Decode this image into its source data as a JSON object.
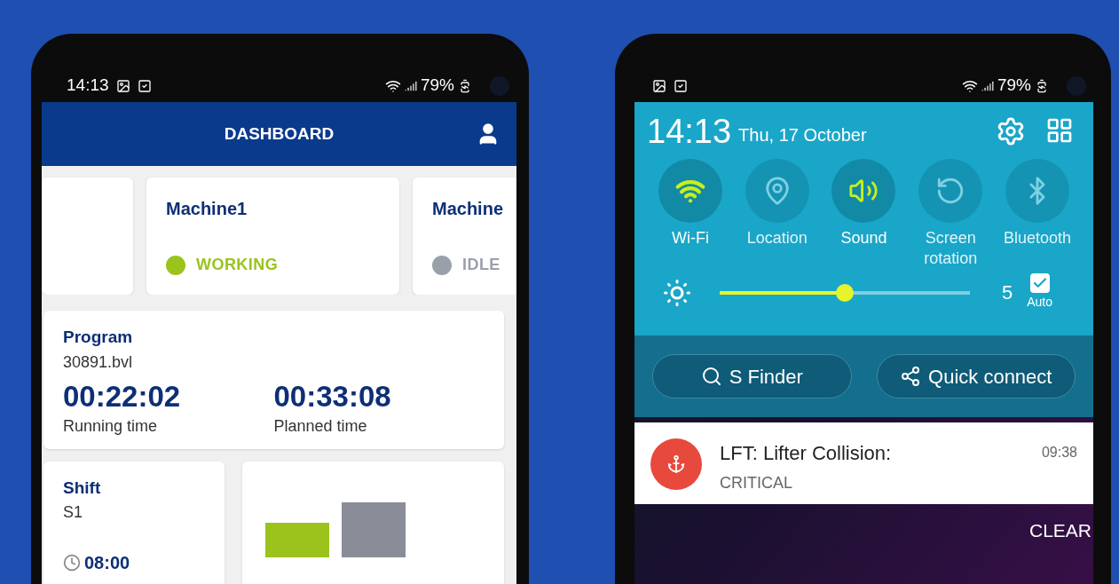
{
  "left_phone": {
    "status_bar": {
      "time": "14:13",
      "battery": "79%"
    },
    "app_bar": {
      "title": "DASHBOARD"
    },
    "machines": [
      {
        "kind": "hidden"
      },
      {
        "kind": "machine",
        "name": "Machine1",
        "status": "WORKING",
        "color": "#9bc31c"
      },
      {
        "kind": "machine",
        "name": "Machine",
        "status": "IDLE",
        "color": "#9aa0aa"
      }
    ],
    "program": {
      "label": "Program",
      "value": "30891.bvl",
      "timers": [
        {
          "value": "00:22:02",
          "label": "Running time"
        },
        {
          "value": "00:33:08",
          "label": "Planned time"
        }
      ]
    },
    "shift": {
      "label": "Shift",
      "value": "S1",
      "start": "08:00"
    }
  },
  "right_phone": {
    "status_bar": {
      "battery": "79%"
    },
    "panel": {
      "time": "14:13",
      "date": "Thu, 17 October",
      "tiles": [
        {
          "kind": "wifi",
          "label": "Wi-Fi",
          "on": true
        },
        {
          "kind": "location",
          "label": "Location",
          "on": false
        },
        {
          "kind": "sound",
          "label": "Sound",
          "on": true
        },
        {
          "kind": "rotation",
          "label": "Screen rotation",
          "on": false
        },
        {
          "kind": "bluetooth",
          "label": "Bluetooth",
          "on": false
        }
      ],
      "brightness": {
        "level": 0.5,
        "value": "5",
        "auto_label": "Auto",
        "auto_checked": true
      }
    },
    "buttons": [
      {
        "kind": "search",
        "label": "S Finder"
      },
      {
        "kind": "connect",
        "label": "Quick connect"
      }
    ],
    "notification": {
      "title": "LFT: Lifter Collision:",
      "subtitle": "CRITICAL",
      "time": "09:38"
    },
    "clear": "CLEAR"
  }
}
